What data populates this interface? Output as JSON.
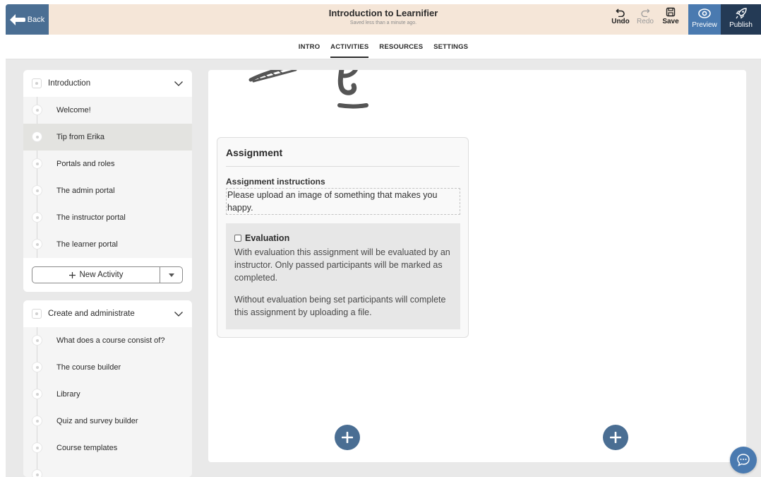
{
  "header": {
    "back_label": "Back",
    "title": "Introduction to Learnifier",
    "subtitle": "Saved less than a minute ago.",
    "undo_label": "Undo",
    "redo_label": "Redo",
    "save_label": "Save",
    "preview_label": "Preview",
    "publish_label": "Publish"
  },
  "tabs": [
    {
      "label": "INTRO"
    },
    {
      "label": "ACTIVITIES",
      "active": true
    },
    {
      "label": "RESOURCES"
    },
    {
      "label": "SETTINGS"
    }
  ],
  "sidebar": {
    "modules": [
      {
        "title": "Introduction",
        "items": [
          {
            "label": "Welcome!"
          },
          {
            "label": "Tip from Erika",
            "active": true
          },
          {
            "label": "Portals and roles"
          },
          {
            "label": "The admin portal"
          },
          {
            "label": "The instructor portal"
          },
          {
            "label": "The learner portal"
          }
        ],
        "new_activity_label": "New Activity"
      },
      {
        "title": "Create and administrate",
        "items": [
          {
            "label": "What does a course consist of?"
          },
          {
            "label": "The course builder"
          },
          {
            "label": "Library"
          },
          {
            "label": "Quiz and survey builder"
          },
          {
            "label": "Course templates"
          }
        ]
      }
    ]
  },
  "assignment": {
    "title": "Assignment",
    "instructions_label": "Assignment instructions",
    "instructions_value": "Please upload an image of something that makes you happy.",
    "evaluation_label": "Evaluation",
    "evaluation_checked": false,
    "evaluation_text_1": "With evaluation this assignment will be evaluated by an instructor. Only passed participants will be marked as completed.",
    "evaluation_text_2": "Without evaluation being set participants will complete this assignment by uploading a file."
  },
  "colors": {
    "accent": "#4a6e93",
    "preview_bg": "#4a7ab0",
    "publish_bg": "#243a55",
    "topbar_bg": "#f5e6d8"
  },
  "icons": [
    "back-arrow-icon",
    "undo-icon",
    "redo-icon",
    "save-icon",
    "eye-icon",
    "rocket-icon",
    "chevron-down-icon",
    "plus-icon",
    "caret-down-icon",
    "chat-icon"
  ]
}
